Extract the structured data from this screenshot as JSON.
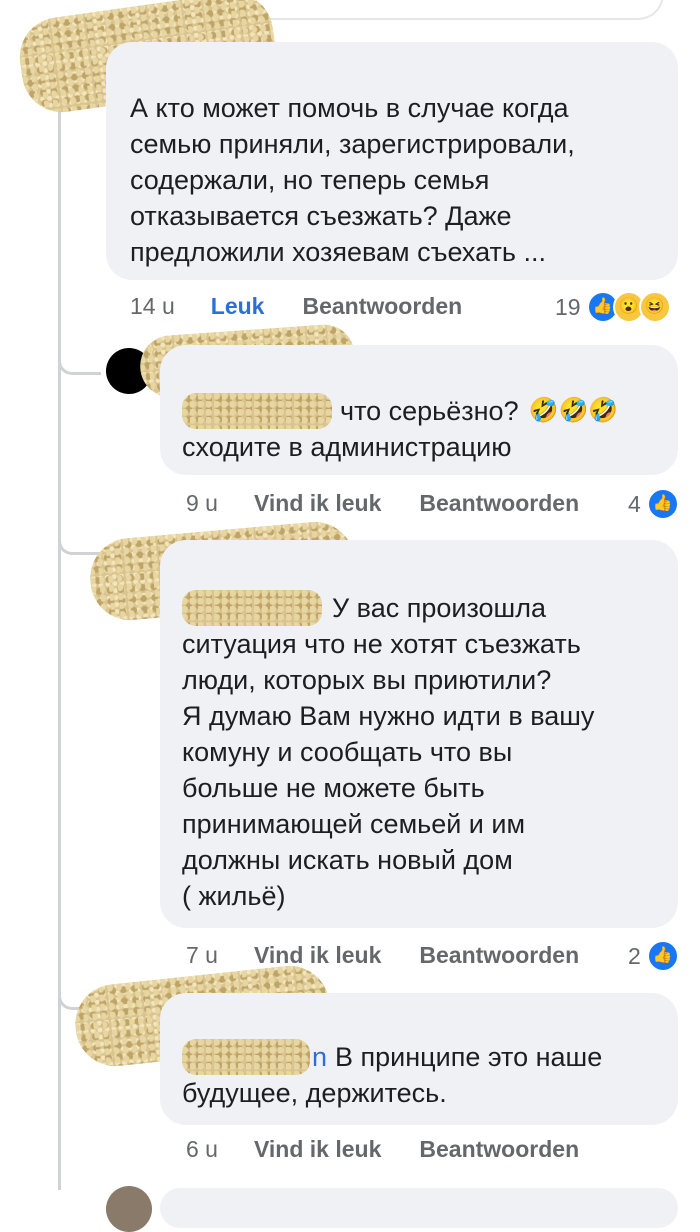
{
  "comments": [
    {
      "text": "А кто может помочь в случае когда\nсемью приняли, зарегистрировали,\nсодержали, но теперь семья\nотказывается съезжать? Даже\nпредложили хозяевам съехать ...",
      "time": "14 u",
      "like": "Leuk",
      "reply": "Beantwoorden",
      "reaction_count": "19",
      "reactions": [
        "like-reaction",
        "wow-reaction",
        "haha-reaction"
      ]
    },
    {
      "text_line1": "что серьёзно?",
      "emojis": "🤣🤣🤣",
      "text_line2": "сходите в администрацию",
      "time": "9 u",
      "like": "Vind ik leuk",
      "reply": "Beantwoorden",
      "reaction_count": "4",
      "reactions": [
        "like-reaction"
      ]
    },
    {
      "text_line1": "У вас произошла",
      "text": "ситуация что не хотят съезжать\nлюди, которых вы приютили?\nЯ думаю Вам нужно идти в вашу\nкомуну и сообщать что вы\nбольше не можете быть\nпринимающей семьей и им\nдолжны искать новый дом\n( жильё)",
      "time": "7 u",
      "like": "Vind ik leuk",
      "reply": "Beantwoorden",
      "reaction_count": "2",
      "reactions": [
        "like-reaction"
      ]
    },
    {
      "name_tail": "n",
      "text_line1": "В принципе это наше",
      "text_line2": "будущее, держитесь.",
      "time": "6 u",
      "like": "Vind ik leuk",
      "reply": "Beantwoorden"
    }
  ],
  "colors": {
    "bubble": "#eff1f4",
    "meta": "#65676b",
    "like_active": "#2d6fd6",
    "like_reaction": "#1877f2"
  }
}
